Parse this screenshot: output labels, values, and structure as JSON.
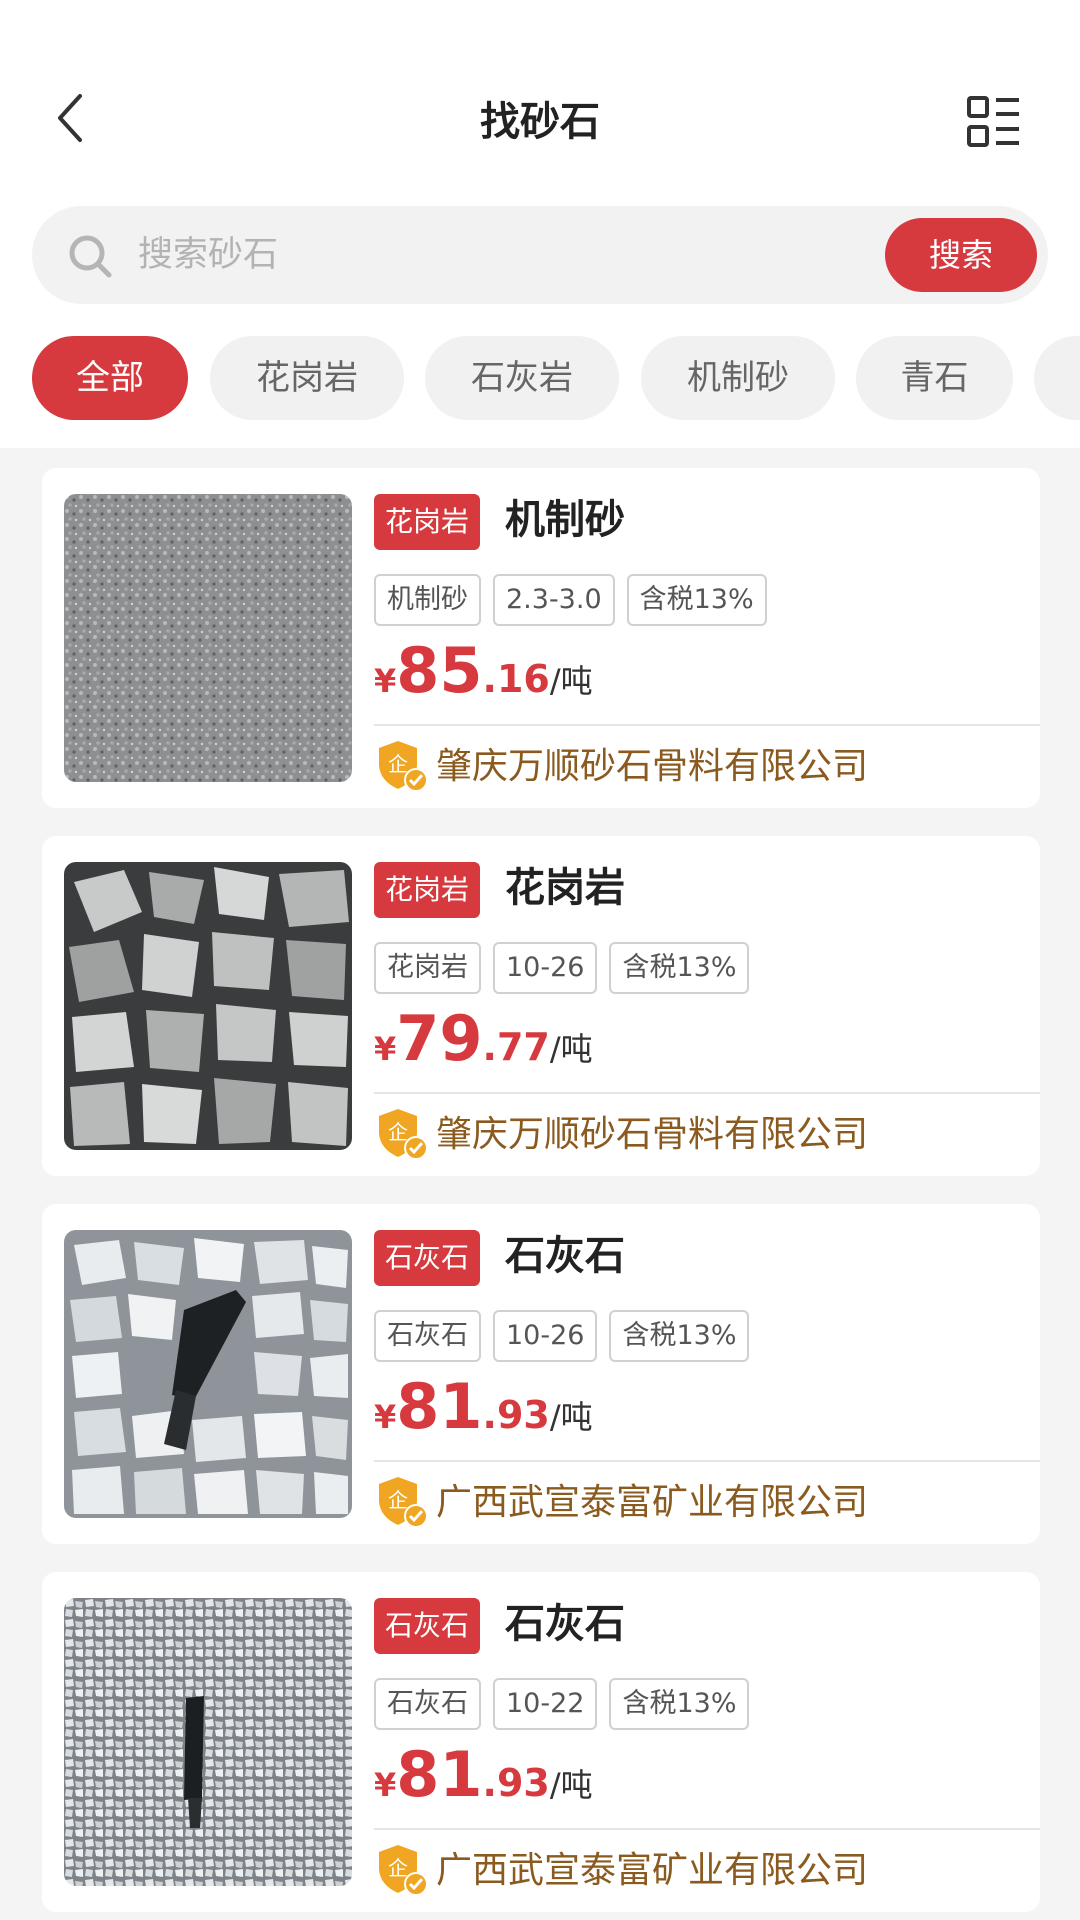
{
  "header": {
    "title": "找砂石"
  },
  "search": {
    "placeholder": "搜索砂石",
    "button_label": "搜索"
  },
  "categories": [
    "全部",
    "花岗岩",
    "石灰岩",
    "机制砂",
    "青石"
  ],
  "active_category": "全部",
  "products": [
    {
      "category_badge": "花岗岩",
      "name": "机制砂",
      "tags": [
        "机制砂",
        "2.3-3.0",
        "含税13%"
      ],
      "currency": "¥",
      "price_int": "85",
      "price_dec": ".16",
      "unit": "/吨",
      "company": "肇庆万顺砂石骨料有限公司"
    },
    {
      "category_badge": "花岗岩",
      "name": "花岗岩",
      "tags": [
        "花岗岩",
        "10-26",
        "含税13%"
      ],
      "currency": "¥",
      "price_int": "79",
      "price_dec": ".77",
      "unit": "/吨",
      "company": "肇庆万顺砂石骨料有限公司"
    },
    {
      "category_badge": "石灰石",
      "name": "石灰石",
      "tags": [
        "石灰石",
        "10-26",
        "含税13%"
      ],
      "currency": "¥",
      "price_int": "81",
      "price_dec": ".93",
      "unit": "/吨",
      "company": "广西武宣泰富矿业有限公司"
    },
    {
      "category_badge": "石灰石",
      "name": "石灰石",
      "tags": [
        "石灰石",
        "10-22",
        "含税13%"
      ],
      "currency": "¥",
      "price_int": "81",
      "price_dec": ".93",
      "unit": "/吨",
      "company": "广西武宣泰富矿业有限公司"
    }
  ],
  "colors": {
    "accent": "#d6393e",
    "company_text": "#8a5a1f",
    "company_icon": "#f0a623"
  },
  "icons": {
    "back": "chevron-left-icon",
    "list": "list-view-icon",
    "search": "search-icon",
    "company": "enterprise-verified-icon"
  }
}
